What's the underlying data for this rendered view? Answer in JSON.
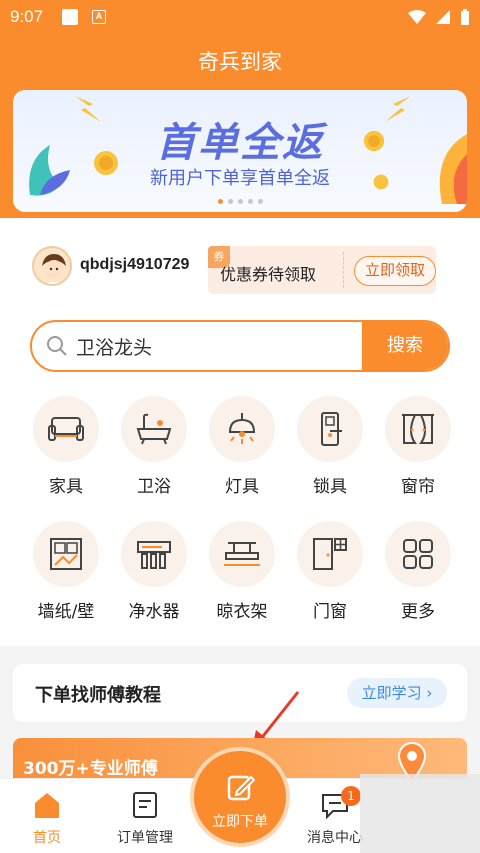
{
  "status_bar": {
    "time": "9:07"
  },
  "app": {
    "title": "奇兵到家"
  },
  "banner": {
    "title": "首单全返",
    "subtitle": "新用户下单享首单全返"
  },
  "user": {
    "username": "qbdjsj4910729"
  },
  "coupon": {
    "tag": "券",
    "text": "优惠券待领取",
    "button": "立即领取"
  },
  "search": {
    "value": "卫浴龙头",
    "button": "搜索"
  },
  "categories": [
    {
      "label": "家具",
      "icon": "sofa-icon"
    },
    {
      "label": "卫浴",
      "icon": "bathtub-icon"
    },
    {
      "label": "灯具",
      "icon": "lamp-icon"
    },
    {
      "label": "锁具",
      "icon": "lock-icon"
    },
    {
      "label": "窗帘",
      "icon": "curtain-icon"
    },
    {
      "label": "墙纸/壁",
      "icon": "wallpaper-icon"
    },
    {
      "label": "净水器",
      "icon": "water-purifier-icon"
    },
    {
      "label": "晾衣架",
      "icon": "drying-rack-icon"
    },
    {
      "label": "门窗",
      "icon": "door-icon"
    },
    {
      "label": "更多",
      "icon": "grid-icon"
    }
  ],
  "tutorial": {
    "title": "下单找师傅教程",
    "button": "立即学习"
  },
  "promo": {
    "text": "300万+专业师傅"
  },
  "nav": {
    "home": "首页",
    "orders": "订单管理",
    "center": "立即下单",
    "messages": "消息中心",
    "message_badge": "1"
  },
  "colors": {
    "accent": "#fb8c2e",
    "banner_text": "#5a6ee0",
    "learn_blue": "#3b8bdc"
  }
}
